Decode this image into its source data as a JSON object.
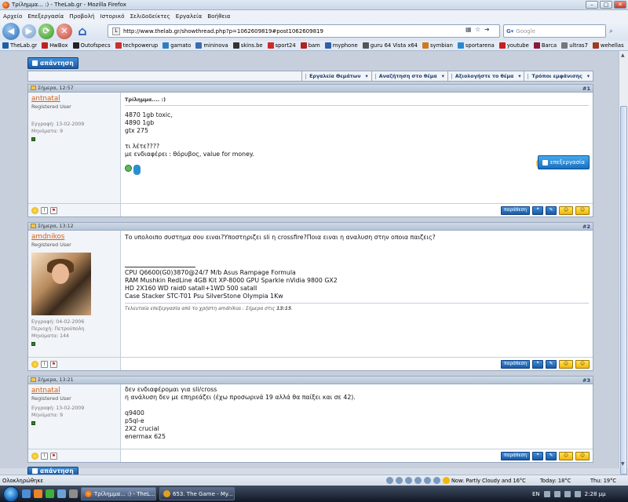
{
  "window": {
    "title": "Τρίλημμα... :) - TheLab.gr - Mozilla Firefox"
  },
  "menu": [
    "Αρχείο",
    "Επεξεργασία",
    "Προβολή",
    "Ιστορικό",
    "Σελιδοδείκτες",
    "Εργαλεία",
    "Βοήθεια"
  ],
  "nav": {
    "url": "http://www.thelab.gr/showthread.php?p=1062609819#post1062609819",
    "search_placeholder": "Google"
  },
  "bookmarks": [
    {
      "label": "TheLab.gr",
      "color": "#1f5fa8"
    },
    {
      "label": "HwBox",
      "color": "#c02020"
    },
    {
      "label": "Outofspecs",
      "color": "#222"
    },
    {
      "label": "techpowerup",
      "color": "#c83030"
    },
    {
      "label": "gamato",
      "color": "#2f7dc0"
    },
    {
      "label": "mininova",
      "color": "#3a6cb0"
    },
    {
      "label": "skins.be",
      "color": "#333"
    },
    {
      "label": "sport24",
      "color": "#d02a2a"
    },
    {
      "label": "bam",
      "color": "#b32020"
    },
    {
      "label": "myphone",
      "color": "#2f5fa8"
    },
    {
      "label": "guru 64 Vista x64",
      "color": "#555"
    },
    {
      "label": "symbian",
      "color": "#d07820"
    },
    {
      "label": "sportarena",
      "color": "#2a8ad0"
    },
    {
      "label": "youtube",
      "color": "#c42020"
    },
    {
      "label": "Barca",
      "color": "#8a1a3a"
    },
    {
      "label": "ultras7",
      "color": "#777"
    },
    {
      "label": "wehellas",
      "color": "#a03a1a"
    }
  ],
  "thread": {
    "reply_label": "απάντηση",
    "tools": [
      "Εργαλεία Θεμάτων",
      "Αναζήτηση στο θέμα",
      "Αξιολογήστε το θέμα",
      "Τρόποι εμφάνισης"
    ]
  },
  "posts": [
    {
      "date": "Σήμερα, 12:57",
      "number": "#1",
      "username": "antnatal",
      "user_title": "Registered User",
      "meta": [
        "Εγγραφή: 13-02-2009",
        "Μηνύματα: 9"
      ],
      "title": "Τρίλημμα.... :)",
      "lines": [
        "4870 1gb toxic,",
        "4890 1gb",
        "gtx 275",
        "",
        "τι λέτε????",
        "με ενδιαφέρει : θόρυβος, value for money."
      ],
      "edit_label": "επεξεργασία",
      "reply_with_quote": "παράθεση"
    },
    {
      "date": "Σήμερα, 13:12",
      "number": "#2",
      "username": "amdnikos",
      "user_title": "Registered User",
      "meta": [
        "Εγγραφή: 04-02-2006",
        "Περιοχή: Πετρούπολη",
        "Μηνύματα: 144"
      ],
      "lines": [
        "Το υπολοιπο συστημα σου ειναι?Υποστηριζει sli η crossfire?Ποια ειναι η αναλυση στην οποια παιζεις?"
      ],
      "signature": [
        "CPU Q6600(G0)3870@24/7 M/b Asus Rampage Formula",
        "RAM Mushkin RedLine 4GB Kit XP-8000 GPU Sparkle nVidia 9800 GX2",
        "HD 2X160 WD raid0 sataII+1WD 500 sataII",
        "Case Stacker STC-T01 Psu SilverStone Olympia 1Kw"
      ],
      "edit_note_prefix": "Τελευταία επεξεργασία από το χρήστη amdnikos : Σήμερα στις ",
      "edit_note_time": "13:15",
      "reply_with_quote": "παράθεση"
    },
    {
      "date": "Σήμερα, 13:21",
      "number": "#3",
      "username": "antnatal",
      "user_title": "Registered User",
      "meta": [
        "Εγγραφή: 13-02-2009",
        "Μηνύματα: 9"
      ],
      "lines": [
        "δεν ενδιαφέρομαι για sli/cross",
        "η ανάλυση δεν με επηρεάζει (έχω προσωρινά 19 αλλά θα παίξει και σε 42).",
        "",
        "q9400",
        "p5ql-e",
        "2X2 crucial",
        "enermax 625"
      ],
      "reply_with_quote": "παράθεση"
    }
  ],
  "status": {
    "text": "Ολοκληρώθηκε",
    "weather": "Now: Partly Cloudy and 16°C",
    "today": "Today: 18°C",
    "thu": "Thu: 19°C"
  },
  "taskbar": {
    "tasks": [
      "Τρίλημμα... :) - TheL...",
      "653. The Game - My..."
    ],
    "lang": "EN",
    "time": "2:28 μμ"
  }
}
